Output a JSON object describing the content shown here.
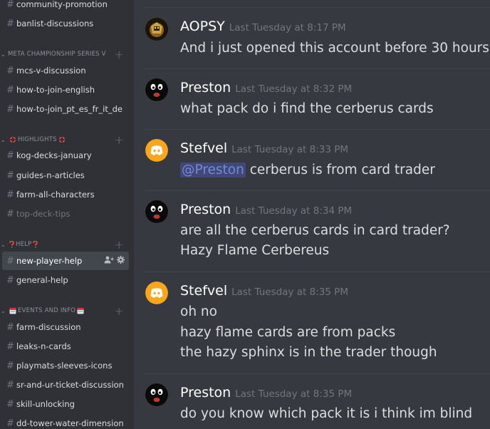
{
  "sidebar": {
    "top_channels": [
      {
        "label": "community-promotion"
      },
      {
        "label": "banlist-discussions"
      }
    ],
    "cat_meta": {
      "label": "META CHAMPIONSHIP SERIES V"
    },
    "meta_channels": [
      {
        "label": "mcs-v-discussion"
      },
      {
        "label": "how-to-join-english"
      },
      {
        "label": "how-to-join_pt_es_fr_it_de"
      }
    ],
    "cat_highlights": {
      "label": "HIGHLIGHTS"
    },
    "highlight_channels": [
      {
        "label": "kog-decks-january"
      },
      {
        "label": "guides-n-articles"
      },
      {
        "label": "farm-all-characters"
      },
      {
        "label": "top-deck-tips"
      }
    ],
    "cat_help": {
      "label": "HELP"
    },
    "help_channels": [
      {
        "label": "new-player-help"
      },
      {
        "label": "general-help"
      }
    ],
    "cat_events": {
      "label": "EVENTS AND INFO"
    },
    "event_channels": [
      {
        "label": "farm-discussion"
      },
      {
        "label": "leaks-n-cards"
      },
      {
        "label": "playmats-sleeves-icons"
      },
      {
        "label": "sr-and-ur-ticket-discussion"
      },
      {
        "label": "skill-unlocking"
      },
      {
        "label": "dd-tower-water-dimension"
      }
    ],
    "glyphs": {
      "hash": "#",
      "plus": "+",
      "chevron": "⌄"
    }
  },
  "messages": [
    {
      "author": "AOPSY",
      "timestamp": "Last Tuesday at 8:17 PM",
      "avatar": "aopsy-avatar-icon",
      "lines": [
        "And i just opened this account before 30 hours"
      ]
    },
    {
      "author": "Preston",
      "timestamp": "Last Tuesday at 8:32 PM",
      "avatar": "dark-face-avatar-icon",
      "lines": [
        "what pack do i find the cerberus cards"
      ]
    },
    {
      "author": "Stefvel",
      "timestamp": "Last Tuesday at 8:33 PM",
      "avatar": "discord-logo-avatar-icon",
      "mention": "@Preston",
      "lines": [
        " cerberus is from card trader"
      ]
    },
    {
      "author": "Preston",
      "timestamp": "Last Tuesday at 8:34 PM",
      "avatar": "dark-face-avatar-icon",
      "lines": [
        "are all the cerberus cards in card trader?",
        "Hazy Flame Cerbereus"
      ]
    },
    {
      "author": "Stefvel",
      "timestamp": "Last Tuesday at 8:35 PM",
      "avatar": "discord-logo-avatar-icon",
      "lines": [
        "oh no",
        "hazy flame cards are from packs",
        "the hazy sphinx is in the trader though"
      ]
    },
    {
      "author": "Preston",
      "timestamp": "Last Tuesday at 8:35 PM",
      "avatar": "dark-face-avatar-icon",
      "lines": [
        "do you know which pack it is i think im blind"
      ]
    }
  ],
  "colors": {
    "sidebar_bg": "#2f3136",
    "chat_bg": "#36393f",
    "mention_bg": "#414776",
    "mention_text": "#7289da",
    "discord_avatar": "#faa61a"
  }
}
